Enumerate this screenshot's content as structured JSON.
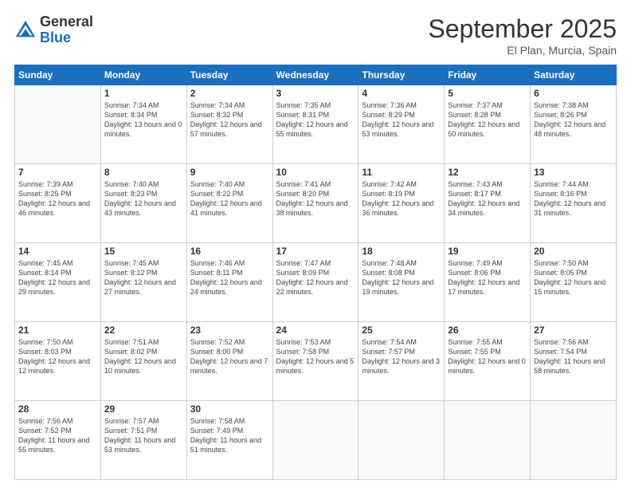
{
  "header": {
    "logo_general": "General",
    "logo_blue": "Blue",
    "month": "September 2025",
    "location": "El Plan, Murcia, Spain"
  },
  "weekdays": [
    "Sunday",
    "Monday",
    "Tuesday",
    "Wednesday",
    "Thursday",
    "Friday",
    "Saturday"
  ],
  "weeks": [
    [
      {
        "day": "",
        "sunrise": "",
        "sunset": "",
        "daylight": ""
      },
      {
        "day": "1",
        "sunrise": "7:34 AM",
        "sunset": "8:34 PM",
        "daylight": "13 hours and 0 minutes."
      },
      {
        "day": "2",
        "sunrise": "7:34 AM",
        "sunset": "8:32 PM",
        "daylight": "12 hours and 57 minutes."
      },
      {
        "day": "3",
        "sunrise": "7:35 AM",
        "sunset": "8:31 PM",
        "daylight": "12 hours and 55 minutes."
      },
      {
        "day": "4",
        "sunrise": "7:36 AM",
        "sunset": "8:29 PM",
        "daylight": "12 hours and 53 minutes."
      },
      {
        "day": "5",
        "sunrise": "7:37 AM",
        "sunset": "8:28 PM",
        "daylight": "12 hours and 50 minutes."
      },
      {
        "day": "6",
        "sunrise": "7:38 AM",
        "sunset": "8:26 PM",
        "daylight": "12 hours and 48 minutes."
      }
    ],
    [
      {
        "day": "7",
        "sunrise": "7:39 AM",
        "sunset": "8:25 PM",
        "daylight": "12 hours and 46 minutes."
      },
      {
        "day": "8",
        "sunrise": "7:40 AM",
        "sunset": "8:23 PM",
        "daylight": "12 hours and 43 minutes."
      },
      {
        "day": "9",
        "sunrise": "7:40 AM",
        "sunset": "8:22 PM",
        "daylight": "12 hours and 41 minutes."
      },
      {
        "day": "10",
        "sunrise": "7:41 AM",
        "sunset": "8:20 PM",
        "daylight": "12 hours and 38 minutes."
      },
      {
        "day": "11",
        "sunrise": "7:42 AM",
        "sunset": "8:19 PM",
        "daylight": "12 hours and 36 minutes."
      },
      {
        "day": "12",
        "sunrise": "7:43 AM",
        "sunset": "8:17 PM",
        "daylight": "12 hours and 34 minutes."
      },
      {
        "day": "13",
        "sunrise": "7:44 AM",
        "sunset": "8:16 PM",
        "daylight": "12 hours and 31 minutes."
      }
    ],
    [
      {
        "day": "14",
        "sunrise": "7:45 AM",
        "sunset": "8:14 PM",
        "daylight": "12 hours and 29 minutes."
      },
      {
        "day": "15",
        "sunrise": "7:45 AM",
        "sunset": "8:12 PM",
        "daylight": "12 hours and 27 minutes."
      },
      {
        "day": "16",
        "sunrise": "7:46 AM",
        "sunset": "8:11 PM",
        "daylight": "12 hours and 24 minutes."
      },
      {
        "day": "17",
        "sunrise": "7:47 AM",
        "sunset": "8:09 PM",
        "daylight": "12 hours and 22 minutes."
      },
      {
        "day": "18",
        "sunrise": "7:48 AM",
        "sunset": "8:08 PM",
        "daylight": "12 hours and 19 minutes."
      },
      {
        "day": "19",
        "sunrise": "7:49 AM",
        "sunset": "8:06 PM",
        "daylight": "12 hours and 17 minutes."
      },
      {
        "day": "20",
        "sunrise": "7:50 AM",
        "sunset": "8:05 PM",
        "daylight": "12 hours and 15 minutes."
      }
    ],
    [
      {
        "day": "21",
        "sunrise": "7:50 AM",
        "sunset": "8:03 PM",
        "daylight": "12 hours and 12 minutes."
      },
      {
        "day": "22",
        "sunrise": "7:51 AM",
        "sunset": "8:02 PM",
        "daylight": "12 hours and 10 minutes."
      },
      {
        "day": "23",
        "sunrise": "7:52 AM",
        "sunset": "8:00 PM",
        "daylight": "12 hours and 7 minutes."
      },
      {
        "day": "24",
        "sunrise": "7:53 AM",
        "sunset": "7:58 PM",
        "daylight": "12 hours and 5 minutes."
      },
      {
        "day": "25",
        "sunrise": "7:54 AM",
        "sunset": "7:57 PM",
        "daylight": "12 hours and 3 minutes."
      },
      {
        "day": "26",
        "sunrise": "7:55 AM",
        "sunset": "7:55 PM",
        "daylight": "12 hours and 0 minutes."
      },
      {
        "day": "27",
        "sunrise": "7:56 AM",
        "sunset": "7:54 PM",
        "daylight": "11 hours and 58 minutes."
      }
    ],
    [
      {
        "day": "28",
        "sunrise": "7:56 AM",
        "sunset": "7:52 PM",
        "daylight": "11 hours and 55 minutes."
      },
      {
        "day": "29",
        "sunrise": "7:57 AM",
        "sunset": "7:51 PM",
        "daylight": "11 hours and 53 minutes."
      },
      {
        "day": "30",
        "sunrise": "7:58 AM",
        "sunset": "7:49 PM",
        "daylight": "11 hours and 51 minutes."
      },
      {
        "day": "",
        "sunrise": "",
        "sunset": "",
        "daylight": ""
      },
      {
        "day": "",
        "sunrise": "",
        "sunset": "",
        "daylight": ""
      },
      {
        "day": "",
        "sunrise": "",
        "sunset": "",
        "daylight": ""
      },
      {
        "day": "",
        "sunrise": "",
        "sunset": "",
        "daylight": ""
      }
    ]
  ]
}
